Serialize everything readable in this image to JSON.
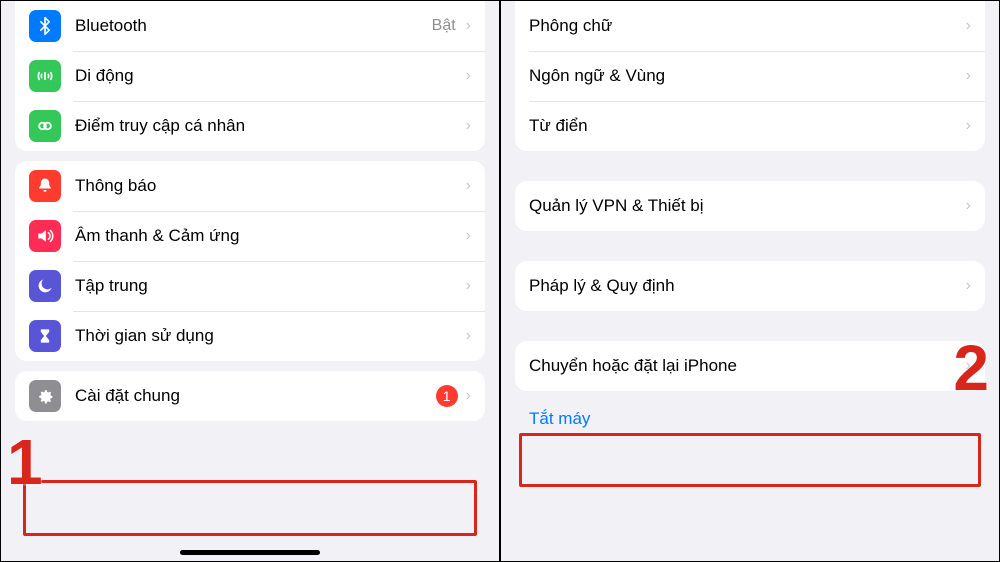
{
  "left": {
    "group1": [
      {
        "icon": "bluetooth",
        "color": "#007aff",
        "label": "Bluetooth",
        "value": "Bật"
      },
      {
        "icon": "cellular",
        "color": "#34c759",
        "label": "Di động"
      },
      {
        "icon": "hotspot",
        "color": "#34c759",
        "label": "Điểm truy cập cá nhân"
      }
    ],
    "group2": [
      {
        "icon": "bell",
        "color": "#ff3b30",
        "label": "Thông báo"
      },
      {
        "icon": "speaker",
        "color": "#ff2d55",
        "label": "Âm thanh & Cảm ứng"
      },
      {
        "icon": "moon",
        "color": "#5856d6",
        "label": "Tập trung"
      },
      {
        "icon": "hourglass",
        "color": "#5856d6",
        "label": "Thời gian sử dụng"
      }
    ],
    "group3": [
      {
        "icon": "gear",
        "color": "#8e8e93",
        "label": "Cài đặt chung",
        "badge": "1"
      }
    ],
    "step": "1"
  },
  "right": {
    "group1": [
      {
        "label": "Phông chữ"
      },
      {
        "label": "Ngôn ngữ & Vùng"
      },
      {
        "label": "Từ điển"
      }
    ],
    "group2": [
      {
        "label": "Quản lý VPN & Thiết bị"
      }
    ],
    "group3": [
      {
        "label": "Pháp lý & Quy định"
      }
    ],
    "group4": [
      {
        "label": "Chuyển hoặc đặt lại iPhone"
      }
    ],
    "shutdown": "Tắt máy",
    "step": "2"
  }
}
